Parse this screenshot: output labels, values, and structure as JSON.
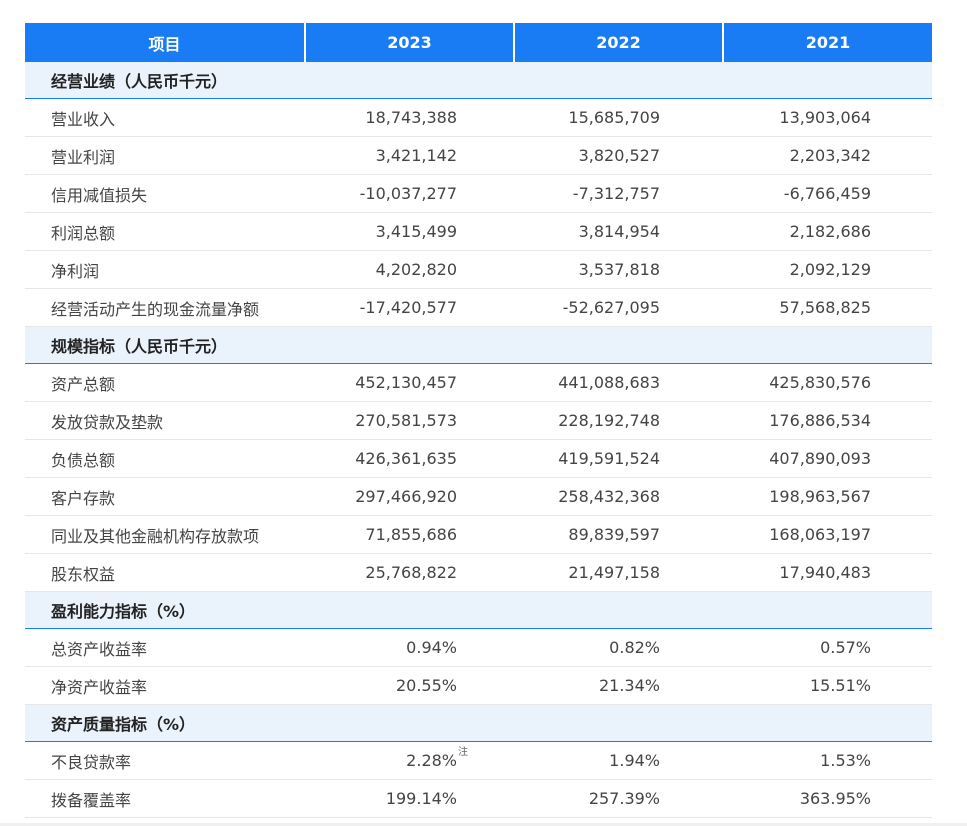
{
  "header": [
    "项目",
    "2023",
    "2022",
    "2021"
  ],
  "sections": [
    {
      "title": "经营业绩（人民币千元）",
      "rows": [
        {
          "label": "营业收入",
          "values": [
            "18,743,388",
            "15,685,709",
            "13,903,064"
          ]
        },
        {
          "label": "营业利润",
          "values": [
            "3,421,142",
            "3,820,527",
            "2,203,342"
          ]
        },
        {
          "label": "信用减值损失",
          "values": [
            "-10,037,277",
            "-7,312,757",
            "-6,766,459"
          ]
        },
        {
          "label": "利润总额",
          "values": [
            "3,415,499",
            "3,814,954",
            "2,182,686"
          ]
        },
        {
          "label": "净利润",
          "values": [
            "4,202,820",
            "3,537,818",
            "2,092,129"
          ]
        },
        {
          "label": "经营活动产生的现金流量净额",
          "values": [
            "-17,420,577",
            "-52,627,095",
            "57,568,825"
          ]
        }
      ]
    },
    {
      "title": "规模指标（人民币千元）",
      "rows": [
        {
          "label": "资产总额",
          "values": [
            "452,130,457",
            "441,088,683",
            "425,830,576"
          ]
        },
        {
          "label": "发放贷款及垫款",
          "values": [
            "270,581,573",
            "228,192,748",
            "176,886,534"
          ]
        },
        {
          "label": "负债总额",
          "values": [
            "426,361,635",
            "419,591,524",
            "407,890,093"
          ]
        },
        {
          "label": "客户存款",
          "values": [
            "297,466,920",
            "258,432,368",
            "198,963,567"
          ]
        },
        {
          "label": "同业及其他金融机构存放款项",
          "values": [
            "71,855,686",
            "89,839,597",
            "168,063,197"
          ]
        },
        {
          "label": "股东权益",
          "values": [
            "25,768,822",
            "21,497,158",
            "17,940,483"
          ]
        }
      ]
    },
    {
      "title": "盈利能力指标（%）",
      "rows": [
        {
          "label": "总资产收益率",
          "values": [
            "0.94%",
            "0.82%",
            "0.57%"
          ]
        },
        {
          "label": "净资产收益率",
          "values": [
            "20.55%",
            "21.34%",
            "15.51%"
          ]
        }
      ]
    },
    {
      "title": "资产质量指标（%）",
      "rows": [
        {
          "label": "不良贷款率",
          "values": [
            "2.28%",
            "1.94%",
            "1.53%"
          ],
          "note": "注"
        },
        {
          "label": "拨备覆盖率",
          "values": [
            "199.14%",
            "257.39%",
            "363.95%"
          ]
        }
      ]
    }
  ]
}
